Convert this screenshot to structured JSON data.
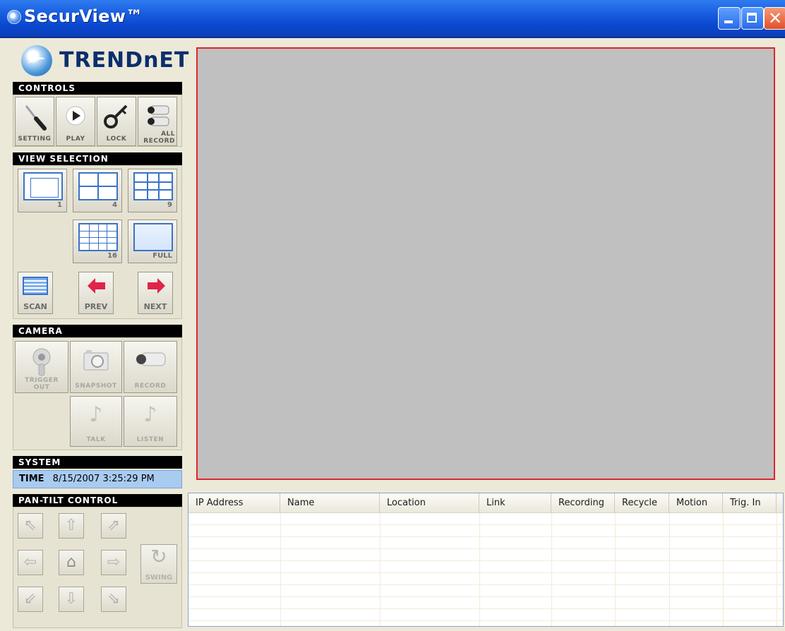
{
  "window": {
    "title": "SecurView™",
    "brand": "TRENDnET",
    "minimize_icon": "minimize-icon",
    "maximize_icon": "maximize-icon",
    "close_icon": "close-icon",
    "close_glyph": "✕"
  },
  "controls": {
    "header": "CONTROLS",
    "buttons": [
      {
        "label": "SETTING",
        "icon": "screwdriver-icon"
      },
      {
        "label": "PLAY",
        "icon": "play-icon"
      },
      {
        "label": "LOCK",
        "icon": "key-icon"
      },
      {
        "label_line1": "ALL",
        "label_line2": "RECORD",
        "icon": "cameras-icon"
      }
    ]
  },
  "view_selection": {
    "header": "VIEW SELECTION",
    "views": [
      {
        "label": "1",
        "icon": "single-view-icon"
      },
      {
        "label": "4",
        "icon": "quad-view-icon"
      },
      {
        "label": "9",
        "icon": "nine-view-icon"
      },
      {
        "label": "16",
        "icon": "sixteen-view-icon"
      },
      {
        "label": "FULL",
        "icon": "full-screen-icon"
      }
    ],
    "nav": [
      {
        "label": "SCAN",
        "icon": "scan-icon"
      },
      {
        "label": "PREV",
        "icon": "left-arrow-icon"
      },
      {
        "label": "NEXT",
        "icon": "right-arrow-icon"
      }
    ]
  },
  "camera": {
    "header": "CAMERA",
    "buttons": [
      {
        "label_line1": "TRIGGER",
        "label_line2": "OUT",
        "icon": "joystick-icon"
      },
      {
        "label": "SNAPSHOT",
        "icon": "camera-snapshot-icon"
      },
      {
        "label": "RECORD",
        "icon": "video-camera-icon"
      },
      {
        "label": "TALK",
        "icon": "music-note-icon"
      },
      {
        "label": "LISTEN",
        "icon": "music-note-icon"
      }
    ]
  },
  "system": {
    "header": "SYSTEM",
    "time_label": "TIME",
    "time_value": "8/15/2007 3:25:29 PM"
  },
  "pan_tilt": {
    "header": "PAN-TILT CONTROL",
    "buttons": [
      {
        "icon": "arrow-up-left-icon",
        "glyph": "⇖"
      },
      {
        "icon": "arrow-up-icon",
        "glyph": "⇧"
      },
      {
        "icon": "arrow-up-right-icon",
        "glyph": "⇗"
      },
      {
        "icon": "arrow-left-icon",
        "glyph": "⇦"
      },
      {
        "icon": "home-icon",
        "glyph": "⌂"
      },
      {
        "icon": "arrow-right-icon",
        "glyph": "⇨"
      },
      {
        "icon": "arrow-down-left-icon",
        "glyph": "⇙"
      },
      {
        "icon": "arrow-down-icon",
        "glyph": "⇩"
      },
      {
        "icon": "arrow-down-right-icon",
        "glyph": "⇘"
      }
    ],
    "swing_label": "SWING",
    "swing_icon": "rotate-icon",
    "swing_glyph": "↻"
  },
  "camera_table": {
    "columns": [
      "IP Address",
      "Name",
      "Location",
      "Link",
      "Recording",
      "Recycle",
      "Motion",
      "Trig. In"
    ]
  },
  "colors": {
    "titlebar": "#0a47d0",
    "video_border": "#e0242a",
    "video_background": "#c0c0c0",
    "time_bar": "#a9cbf0"
  }
}
